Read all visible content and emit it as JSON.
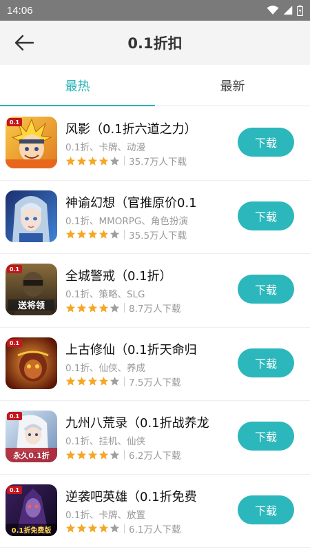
{
  "status_bar": {
    "time": "14:06"
  },
  "header": {
    "title": "0.1折扣"
  },
  "tabs": [
    {
      "label": "最热",
      "active": true
    },
    {
      "label": "最新",
      "active": false
    }
  ],
  "colors": {
    "accent": "#26b3b8",
    "star_filled": "#f5a623",
    "star_empty": "#9e9e9e"
  },
  "games": [
    {
      "name": "风影（0.1折六道之力）",
      "tags": "0.1折、卡牌、动漫",
      "rating": 4,
      "downloads": "35.7万人下载",
      "button": "下载"
    },
    {
      "name": "神谕幻想（官推原价0.1",
      "tags": "0.1折、MMORPG、角色扮演",
      "rating": 4,
      "downloads": "35.5万人下载",
      "button": "下载"
    },
    {
      "name": "全城警戒（0.1折）",
      "tags": "0.1折、策略、SLG",
      "rating": 4,
      "downloads": "8.7万人下载",
      "button": "下载"
    },
    {
      "name": "上古修仙（0.1折天命归",
      "tags": "0.1折、仙侠、养成",
      "rating": 4,
      "downloads": "7.5万人下载",
      "button": "下载"
    },
    {
      "name": "九州八荒录（0.1折战养龙",
      "tags": "0.1折、挂机、仙侠",
      "rating": 4,
      "downloads": "6.2万人下载",
      "button": "下载"
    },
    {
      "name": "逆袭吧英雄（0.1折免费",
      "tags": "0.1折、卡牌、放置",
      "rating": 4,
      "downloads": "6.1万人下载",
      "button": "下载"
    }
  ],
  "icon_texts": [
    "送将领",
    "永久0.1折",
    "0.1折免费版"
  ]
}
